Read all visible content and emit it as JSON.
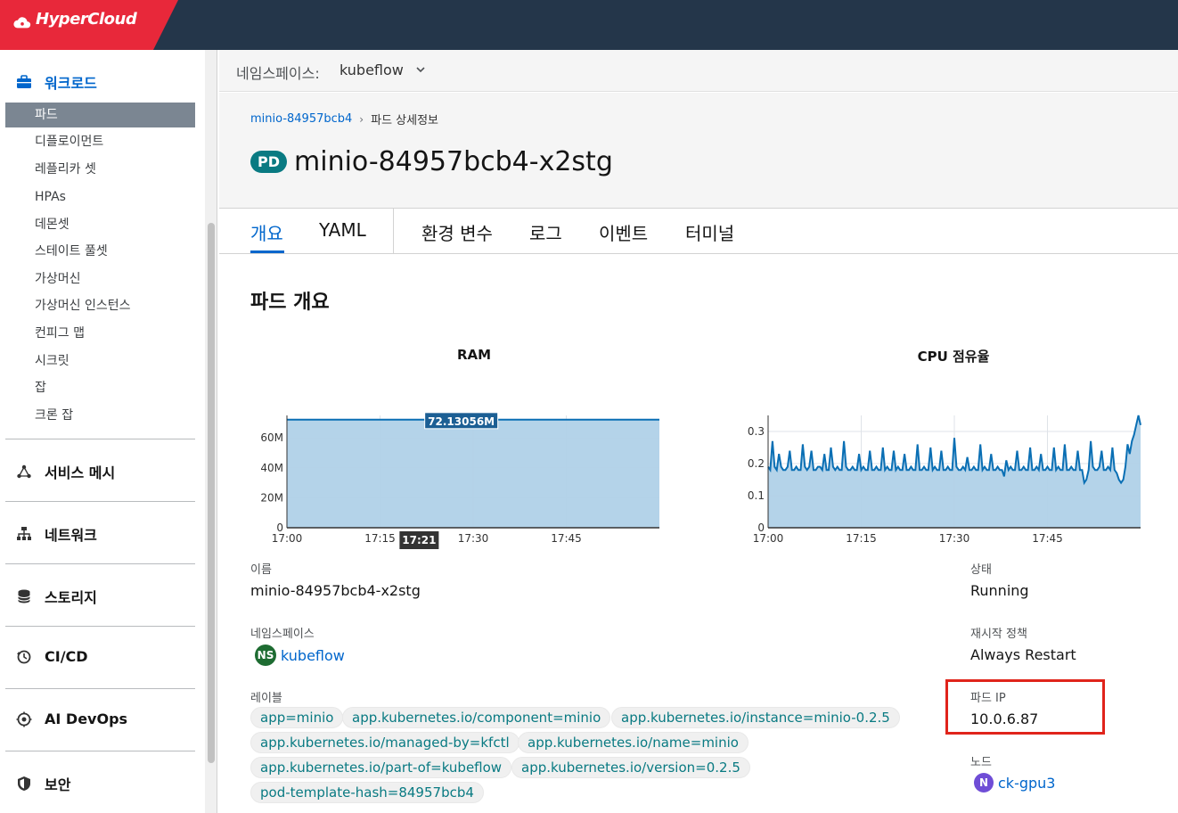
{
  "app": {
    "brand": "HyperCloud"
  },
  "sidebar": {
    "workload": {
      "label": "워크로드",
      "items": [
        {
          "label": "파드",
          "active": true
        },
        {
          "label": "디플로이먼트"
        },
        {
          "label": "레플리카 셋"
        },
        {
          "label": "HPAs"
        },
        {
          "label": "데몬셋"
        },
        {
          "label": "스테이트 풀셋"
        },
        {
          "label": "가상머신"
        },
        {
          "label": "가상머신 인스턴스"
        },
        {
          "label": "컨피그 맵"
        },
        {
          "label": "시크릿"
        },
        {
          "label": "잡"
        },
        {
          "label": "크론 잡"
        }
      ]
    },
    "groups": [
      {
        "label": "서비스 메시",
        "icon": "service-mesh-icon"
      },
      {
        "label": "네트워크",
        "icon": "network-icon"
      },
      {
        "label": "스토리지",
        "icon": "storage-icon"
      },
      {
        "label": "CI/CD",
        "icon": "cicd-icon"
      },
      {
        "label": "AI DevOps",
        "icon": "ai-devops-icon"
      },
      {
        "label": "보안",
        "icon": "security-icon"
      }
    ]
  },
  "namespace_bar": {
    "label": "네임스페이스:",
    "value": "kubeflow"
  },
  "breadcrumb": {
    "parent": "minio-84957bcb4",
    "current": "파드 상세정보"
  },
  "header": {
    "badge": "PD",
    "title": "minio-84957bcb4-x2stg"
  },
  "tabs": [
    {
      "label": "개요",
      "active": true
    },
    {
      "label": "YAML"
    },
    {
      "label": "환경 변수"
    },
    {
      "label": "로그"
    },
    {
      "label": "이벤트"
    },
    {
      "label": "터미널"
    }
  ],
  "overview": {
    "title": "파드 개요"
  },
  "colors": {
    "accent": "#0066cc",
    "chart_fill": "#b0d1e8",
    "chart_line": "#0a6fb4",
    "highlight": "#e0241b"
  },
  "chart_data": [
    {
      "type": "area",
      "title": "RAM",
      "x_ticks": [
        "17:00",
        "17:15",
        "17:30",
        "17:45"
      ],
      "y_ticks": [
        "0",
        "20M",
        "40M",
        "60M"
      ],
      "ylim": [
        0,
        75
      ],
      "y_unit": "M",
      "series": [
        {
          "values": [
            72.13,
            72.13,
            72.13,
            72.13,
            72.13,
            72.13,
            72.13,
            72.13,
            72.13,
            72.13,
            72.13,
            72.13
          ]
        }
      ],
      "tooltip": {
        "value": "72.13056M",
        "time": "17:21"
      }
    },
    {
      "type": "area",
      "title": "CPU 점유율",
      "x_ticks": [
        "17:00",
        "17:15",
        "17:30",
        "17:45"
      ],
      "y_ticks": [
        "0",
        "0.1",
        "0.2",
        "0.3"
      ],
      "ylim": [
        0,
        0.35
      ],
      "series": [
        {
          "values": [
            0.19,
            0.18,
            0.27,
            0.19,
            0.18,
            0.23,
            0.19,
            0.18,
            0.18,
            0.19,
            0.24,
            0.18,
            0.18,
            0.19,
            0.18,
            0.18,
            0.26,
            0.19,
            0.18,
            0.19,
            0.24,
            0.18,
            0.18,
            0.19,
            0.19,
            0.18,
            0.23,
            0.18,
            0.18,
            0.25,
            0.19,
            0.18,
            0.19,
            0.18,
            0.18,
            0.27,
            0.19,
            0.18,
            0.18,
            0.19,
            0.18,
            0.18,
            0.23,
            0.18,
            0.19,
            0.18,
            0.18,
            0.24,
            0.18,
            0.18,
            0.19,
            0.18,
            0.18,
            0.25,
            0.18,
            0.19,
            0.18,
            0.18,
            0.24,
            0.18,
            0.19,
            0.18,
            0.18,
            0.23,
            0.18,
            0.18,
            0.19,
            0.18,
            0.18,
            0.26,
            0.18,
            0.18,
            0.19,
            0.18,
            0.18,
            0.25,
            0.18,
            0.19,
            0.18,
            0.18,
            0.24,
            0.18,
            0.18,
            0.19,
            0.18,
            0.18,
            0.28,
            0.19,
            0.18,
            0.18,
            0.19,
            0.18,
            0.22,
            0.18,
            0.18,
            0.19,
            0.18,
            0.18,
            0.26,
            0.18,
            0.19,
            0.18,
            0.18,
            0.23,
            0.18,
            0.18,
            0.19,
            0.18,
            0.18,
            0.16,
            0.21,
            0.18,
            0.19,
            0.18,
            0.18,
            0.24,
            0.18,
            0.18,
            0.19,
            0.18,
            0.18,
            0.25,
            0.18,
            0.18,
            0.19,
            0.18,
            0.23,
            0.18,
            0.18,
            0.19,
            0.18,
            0.18,
            0.25,
            0.18,
            0.19,
            0.18,
            0.18,
            0.26,
            0.18,
            0.18,
            0.19,
            0.18,
            0.18,
            0.24,
            0.18,
            0.18,
            0.14,
            0.15,
            0.18,
            0.27,
            0.19,
            0.18,
            0.18,
            0.19,
            0.24,
            0.18,
            0.18,
            0.19,
            0.18,
            0.25,
            0.18,
            0.17,
            0.15,
            0.14,
            0.15,
            0.19,
            0.26,
            0.23,
            0.27,
            0.29,
            0.32,
            0.35,
            0.32
          ]
        }
      ]
    }
  ],
  "details": {
    "name_label": "이름",
    "name_value": "minio-84957bcb4-x2stg",
    "namespace_label": "네임스페이스",
    "namespace_badge": "NS",
    "namespace_value": "kubeflow",
    "labels_label": "레이블",
    "labels": [
      "app=minio",
      "app.kubernetes.io/component=minio",
      "app.kubernetes.io/instance=minio-0.2.5",
      "app.kubernetes.io/managed-by=kfctl",
      "app.kubernetes.io/name=minio",
      "app.kubernetes.io/part-of=kubeflow",
      "app.kubernetes.io/version=0.2.5",
      "pod-template-hash=84957bcb4"
    ],
    "status_label": "상태",
    "status_value": "Running",
    "restart_label": "재시작 정책",
    "restart_value": "Always Restart",
    "pod_ip_label": "파드 IP",
    "pod_ip_value": "10.0.6.87",
    "node_label": "노드",
    "node_badge": "N",
    "node_value": "ck-gpu3"
  }
}
